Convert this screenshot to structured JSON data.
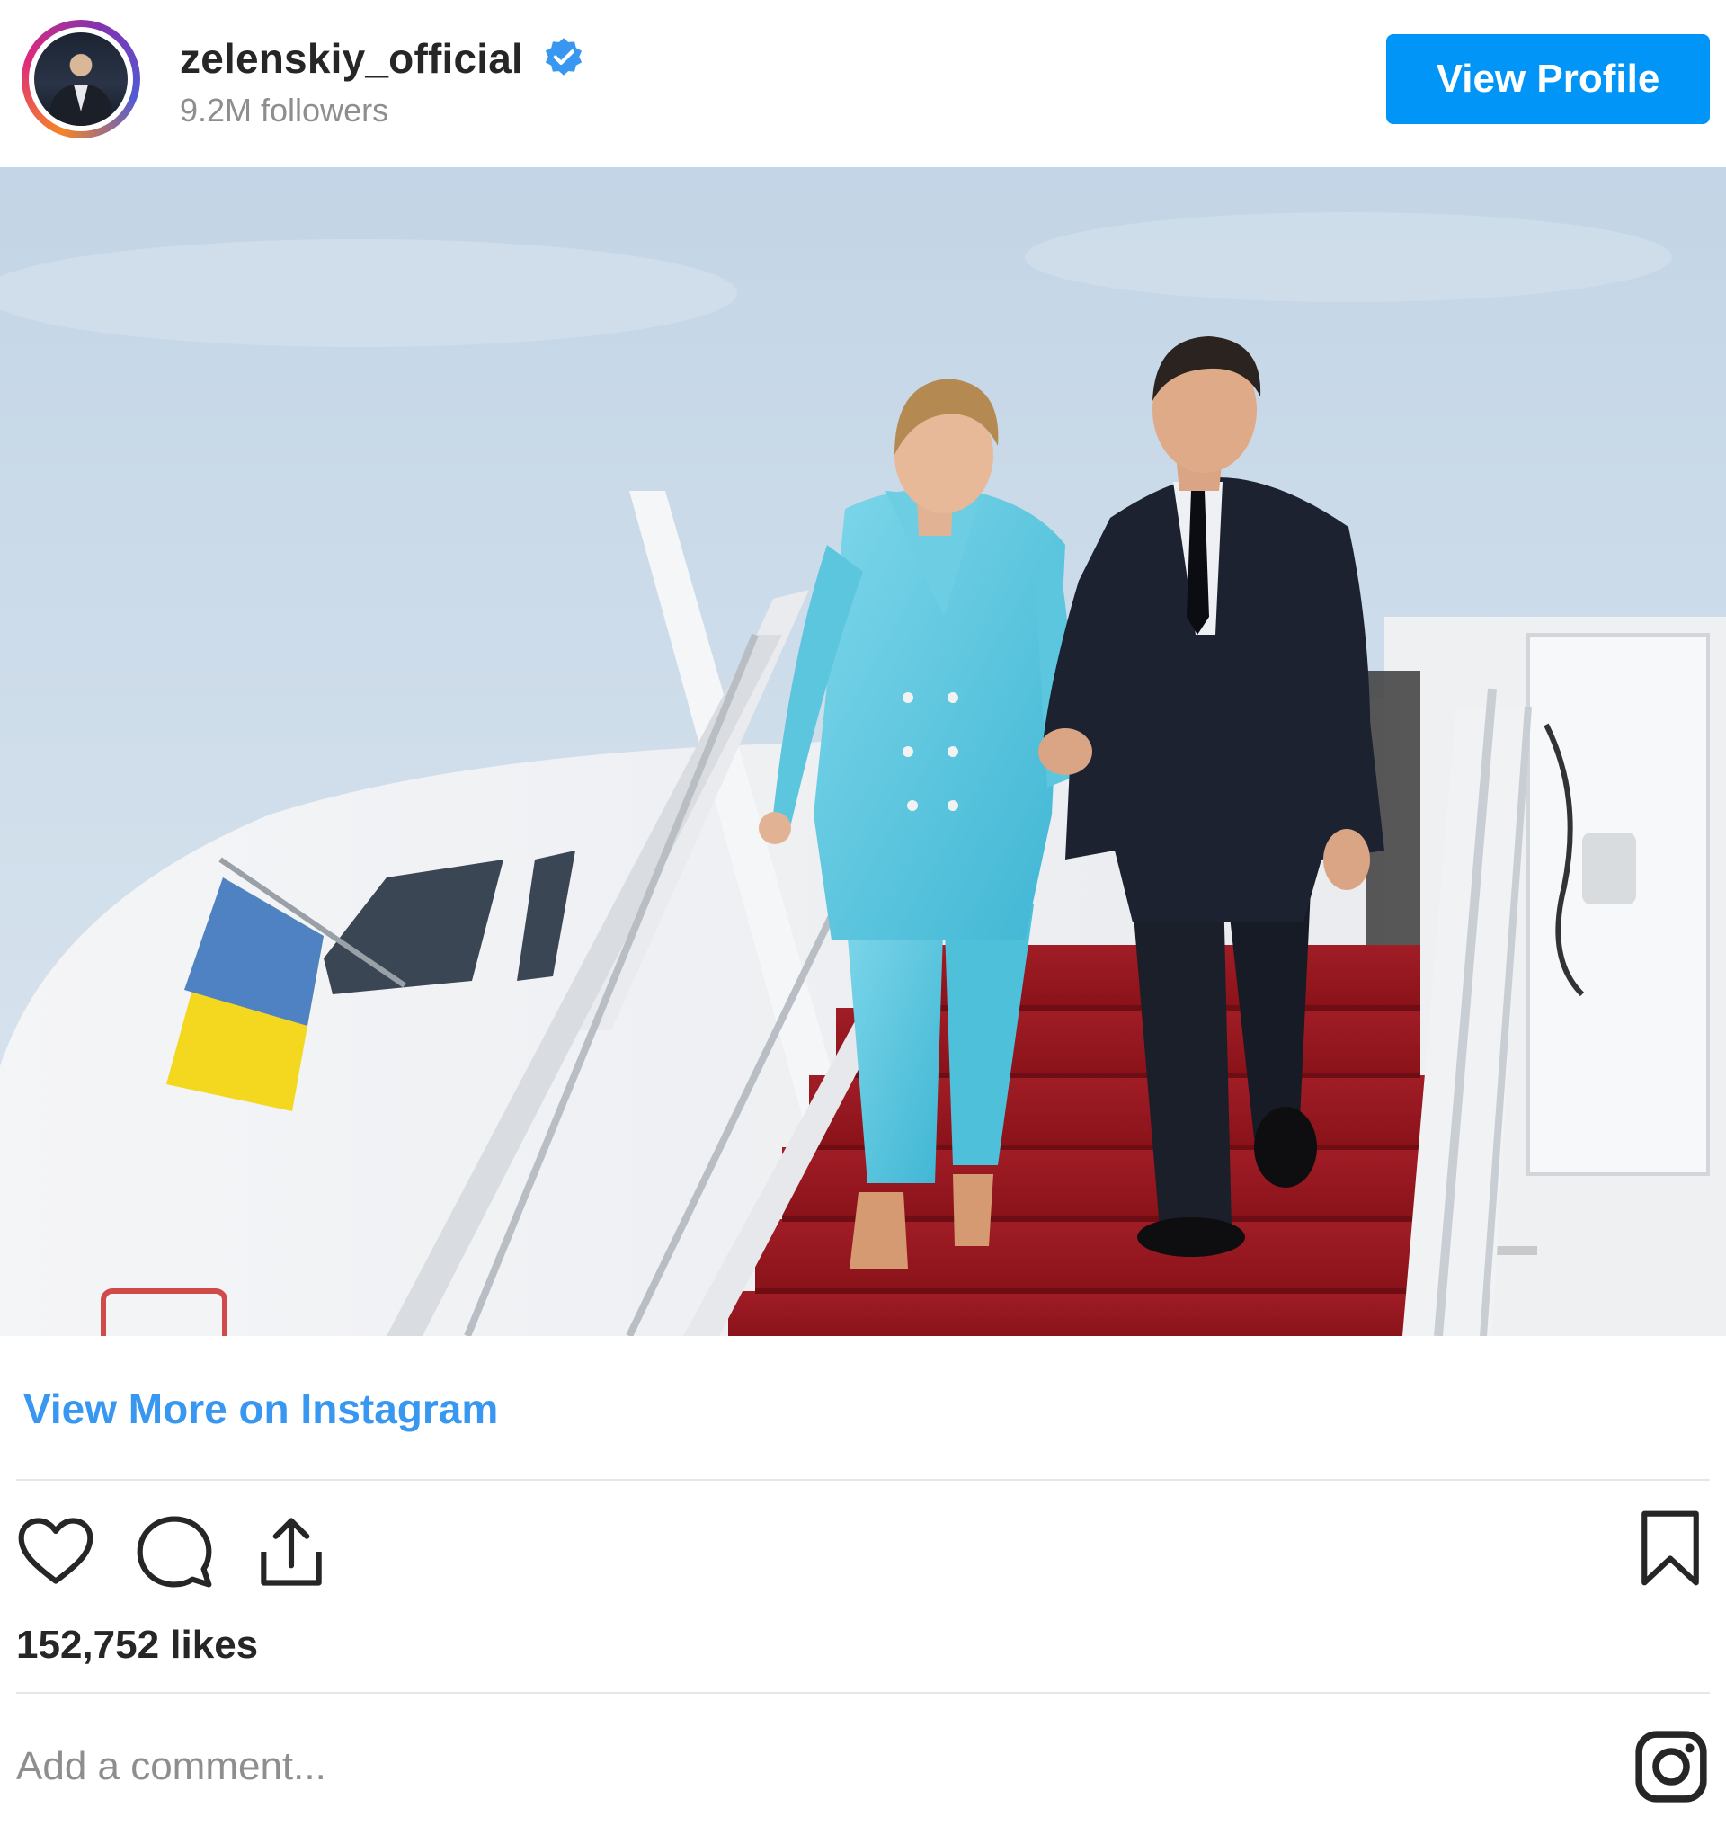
{
  "header": {
    "username": "zelenskiy_official",
    "verified": true,
    "followers": "9.2M followers",
    "view_profile_label": "View Profile"
  },
  "post": {
    "image_alt": "",
    "view_more_label": "View More on Instagram",
    "likes": "152,752 likes",
    "comment_placeholder": "Add a comment..."
  },
  "actions": {
    "icons": [
      "heart-icon",
      "comment-icon",
      "share-icon",
      "bookmark-icon",
      "instagram-logo-icon"
    ]
  },
  "colors": {
    "accent": "#0095f6",
    "link": "#3897f0",
    "muted": "#8e8e8e",
    "text": "#262626"
  }
}
